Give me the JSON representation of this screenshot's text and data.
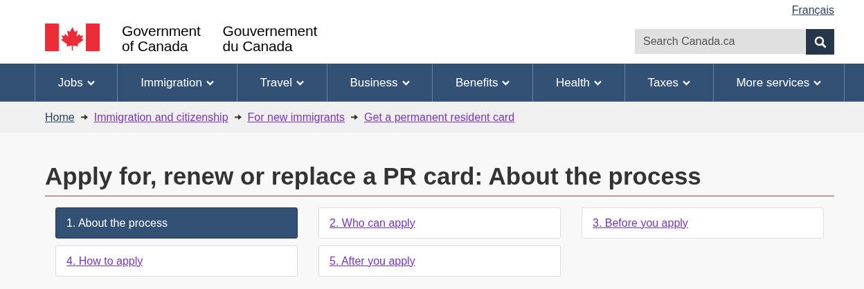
{
  "language_link": "Français",
  "wordmark": {
    "english": [
      "Government",
      "of Canada"
    ],
    "french": [
      "Gouvernement",
      "du Canada"
    ]
  },
  "search": {
    "placeholder": "Search Canada.ca"
  },
  "nav": [
    {
      "label": "Jobs"
    },
    {
      "label": "Immigration"
    },
    {
      "label": "Travel"
    },
    {
      "label": "Business"
    },
    {
      "label": "Benefits"
    },
    {
      "label": "Health"
    },
    {
      "label": "Taxes"
    },
    {
      "label": "More services"
    }
  ],
  "breadcrumbs": [
    {
      "label": "Home",
      "visited": false
    },
    {
      "label": "Immigration and citizenship",
      "visited": true
    },
    {
      "label": "For new immigrants",
      "visited": true
    },
    {
      "label": "Get a permanent resident card",
      "visited": true
    }
  ],
  "title": "Apply for, renew or replace a PR card: About the process",
  "steps": [
    {
      "label": "1. About the process",
      "selected": true
    },
    {
      "label": "2. Who can apply",
      "selected": false
    },
    {
      "label": "3. Before you apply",
      "selected": false
    },
    {
      "label": "4. How to apply",
      "selected": false
    },
    {
      "label": "5. After you apply",
      "selected": false
    }
  ]
}
